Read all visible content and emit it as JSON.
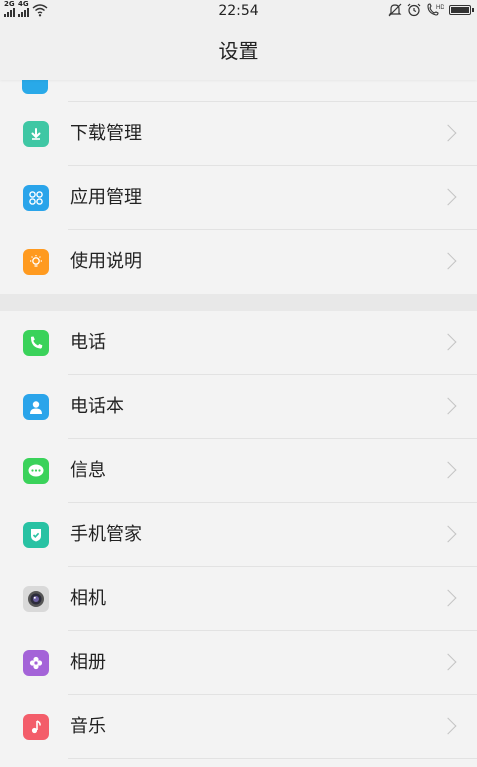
{
  "status_bar": {
    "signal1_net": "2G",
    "signal2_net": "4G",
    "time": "22:54"
  },
  "title": "设置",
  "group1": [
    {
      "label": "下载管理",
      "icon": "download-icon",
      "color": "#3fc7a4"
    },
    {
      "label": "应用管理",
      "icon": "apps-icon",
      "color": "#2aa4ea"
    },
    {
      "label": "使用说明",
      "icon": "lightbulb-icon",
      "color": "#ff9a1f"
    }
  ],
  "group2": [
    {
      "label": "电话",
      "icon": "phone-icon",
      "color": "#3ad25a"
    },
    {
      "label": "电话本",
      "icon": "contacts-icon",
      "color": "#2aa4ea"
    },
    {
      "label": "信息",
      "icon": "message-icon",
      "color": "#3ad25a"
    },
    {
      "label": "手机管家",
      "icon": "shield-icon",
      "color": "#28c2a3"
    },
    {
      "label": "相机",
      "icon": "camera-icon",
      "color": "#bfbfbf"
    },
    {
      "label": "相册",
      "icon": "gallery-icon",
      "color": "#a463d8"
    },
    {
      "label": "音乐",
      "icon": "music-icon",
      "color": "#f35d6a"
    }
  ]
}
